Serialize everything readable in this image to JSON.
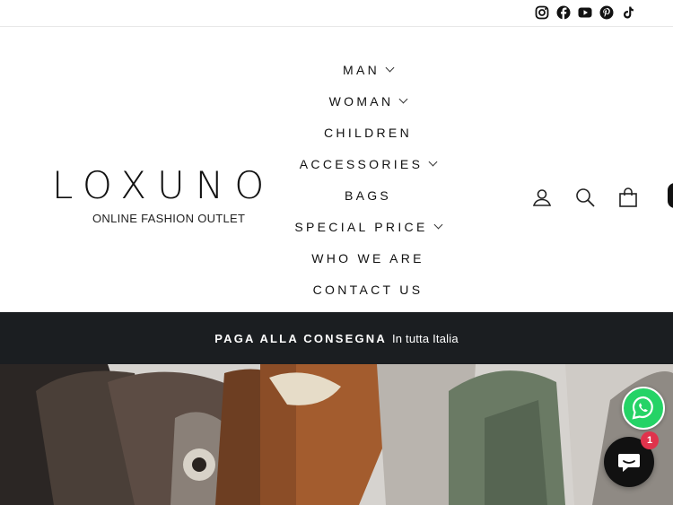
{
  "social": {
    "icons": [
      "instagram-icon",
      "facebook-icon",
      "youtube-icon",
      "pinterest-icon",
      "tiktok-icon"
    ]
  },
  "brand": {
    "name": "LOXUNO",
    "tagline": "ONLINE FASHION OUTLET"
  },
  "nav": {
    "items": [
      {
        "label": "MAN",
        "has_dropdown": true
      },
      {
        "label": "WOMAN",
        "has_dropdown": true
      },
      {
        "label": "CHILDREN",
        "has_dropdown": false
      },
      {
        "label": "ACCESSORIES",
        "has_dropdown": true
      },
      {
        "label": "BAGS",
        "has_dropdown": false
      },
      {
        "label": "SPECIAL PRICE",
        "has_dropdown": true
      },
      {
        "label": "WHO WE ARE",
        "has_dropdown": false
      },
      {
        "label": "CONTACT US",
        "has_dropdown": false
      }
    ]
  },
  "header_icons": [
    "user-icon",
    "search-icon",
    "cart-icon"
  ],
  "announcement": {
    "strong": "PAGA ALLA CONSEGNA",
    "rest": "In tutta Italia"
  },
  "chat_widget": {
    "badge_count": "1"
  },
  "colors": {
    "announcement_bg": "#1b1e21",
    "whatsapp": "#25d366",
    "badge": "#e0334c"
  }
}
